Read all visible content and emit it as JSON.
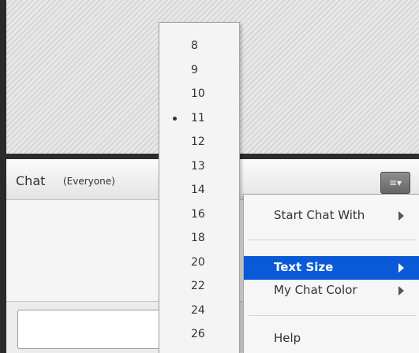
{
  "chat": {
    "title": "Chat",
    "scope": "(Everyone)",
    "menu_button_glyph": "≡▾",
    "input_value": ""
  },
  "text_size_menu": {
    "items": [
      "8",
      "9",
      "10",
      "11",
      "12",
      "13",
      "14",
      "16",
      "18",
      "20",
      "22",
      "24",
      "26"
    ],
    "selected": "11"
  },
  "context_menu": {
    "start_chat_with": "Start Chat With",
    "text_size": "Text Size",
    "my_chat_color": "My Chat Color",
    "help": "Help"
  },
  "colors": {
    "highlight": "#0a5ad7",
    "divider": "#2c2c2c"
  }
}
